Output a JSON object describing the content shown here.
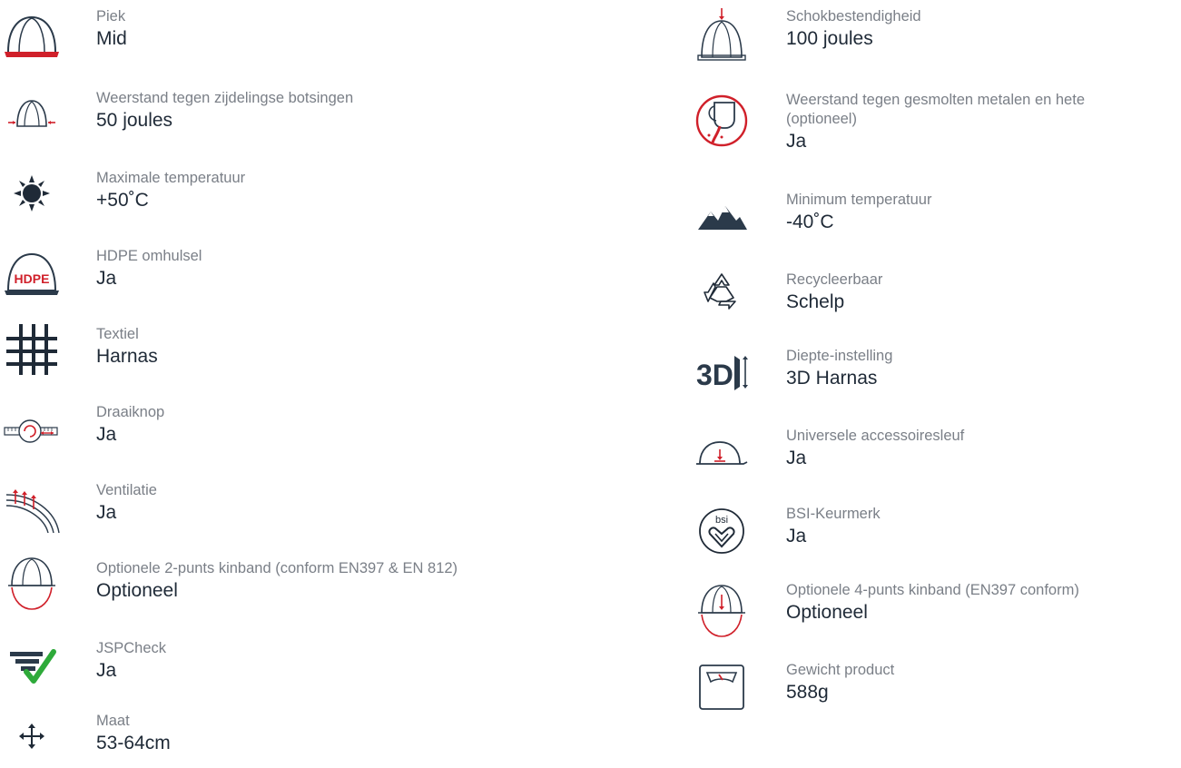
{
  "left": [
    {
      "label": "Piek",
      "value": "Mid",
      "icon": "helmet-peak-icon"
    },
    {
      "label": "Weerstand tegen zijdelingse botsingen",
      "value": "50 joules",
      "icon": "helmet-side-impact-icon"
    },
    {
      "label": "Maximale temperatuur",
      "value": "+50˚C",
      "icon": "sun-icon"
    },
    {
      "label": "HDPE omhulsel",
      "value": "Ja",
      "icon": "hdpe-helmet-icon"
    },
    {
      "label": "Textiel",
      "value": "Harnas",
      "icon": "textile-grid-icon"
    },
    {
      "label": "Draaiknop",
      "value": "Ja",
      "icon": "wheel-ratchet-icon"
    },
    {
      "label": "Ventilatie",
      "value": "Ja",
      "icon": "ventilation-icon"
    },
    {
      "label": "Optionele 2-punts kinband (conform EN397 & EN 812)",
      "value": "Optioneel",
      "icon": "helmet-chinstrap-2pt-icon"
    },
    {
      "label": "JSPCheck",
      "value": "Ja",
      "icon": "jspcheck-icon"
    },
    {
      "label": "Maat",
      "value": "53-64cm",
      "icon": "size-arrows-icon"
    }
  ],
  "right": [
    {
      "label": "Schokbestendigheid",
      "value": "100 joules",
      "icon": "helmet-shock-icon"
    },
    {
      "label": "Weerstand tegen gesmolten metalen en hete",
      "label2": "(optioneel)",
      "value": "Ja",
      "icon": "molten-metal-icon"
    },
    {
      "label": "Minimum temperatuur",
      "value": "-40˚C",
      "icon": "mountains-icon"
    },
    {
      "label": "Recycleerbaar",
      "value": "Schelp",
      "icon": "recycle-icon"
    },
    {
      "label": "Diepte-instelling",
      "value": "3D Harnas",
      "icon": "3d-depth-icon"
    },
    {
      "label": "Universele accessoiresleuf",
      "value": "Ja",
      "icon": "accessory-slot-icon"
    },
    {
      "label": "BSI-Keurmerk",
      "value": "Ja",
      "icon": "bsi-kitemark-icon"
    },
    {
      "label": "Optionele 4-punts kinband (EN397 conform)",
      "value": "Optioneel",
      "icon": "helmet-chinstrap-4pt-icon"
    },
    {
      "label": "Gewicht product",
      "value": "588g",
      "icon": "weight-scale-icon"
    }
  ],
  "colors": {
    "dark": "#2b3a4a",
    "red": "#d0202a",
    "green": "#2eaa3a",
    "label": "#7a7f87"
  }
}
